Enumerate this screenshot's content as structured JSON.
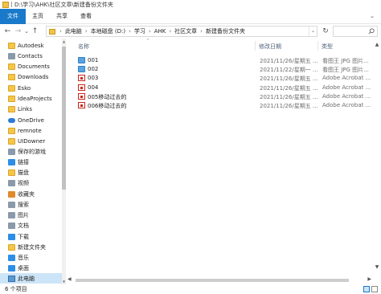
{
  "window": {
    "title": "D:\\学习\\AHK\\社区文章\\新建备份文件夹"
  },
  "ribbon": {
    "tabs": [
      "文件",
      "主页",
      "共享",
      "查看"
    ],
    "expand_glyph": "⌄"
  },
  "nav": {
    "back": "←",
    "forward": "→",
    "recent": "⌄",
    "up": "↑",
    "refresh": "↻",
    "address_dropdown": "⌄"
  },
  "breadcrumb": [
    "此电脑",
    "本地磁盘 (D:)",
    "学习",
    "AHK",
    "社区文章",
    "新建备份文件夹"
  ],
  "search": {
    "placeholder": ""
  },
  "sidebar": {
    "items": [
      {
        "label": "Autodesk",
        "icon": "folder-icon"
      },
      {
        "label": "Contacts",
        "icon": "contacts-icon"
      },
      {
        "label": "Documents",
        "icon": "documents-icon"
      },
      {
        "label": "Downloads",
        "icon": "downloads-icon"
      },
      {
        "label": "Esko",
        "icon": "folder-icon"
      },
      {
        "label": "IdeaProjects",
        "icon": "folder-icon"
      },
      {
        "label": "Links",
        "icon": "links-icon"
      },
      {
        "label": "OneDrive",
        "icon": "onedrive-icon"
      },
      {
        "label": "remnote",
        "icon": "folder-icon"
      },
      {
        "label": "UIDowner",
        "icon": "folder-icon"
      },
      {
        "label": "保存的游戏",
        "icon": "saved-games-icon"
      },
      {
        "label": "链接",
        "icon": "links-icon"
      },
      {
        "label": "猫盘",
        "icon": "folder-icon"
      },
      {
        "label": "视频",
        "icon": "videos-icon"
      },
      {
        "label": "收藏夹",
        "icon": "favorites-icon"
      },
      {
        "label": "搜索",
        "icon": "search-icon"
      },
      {
        "label": "图片",
        "icon": "pictures-icon"
      },
      {
        "label": "文档",
        "icon": "documents-icon"
      },
      {
        "label": "下载",
        "icon": "downloads-icon"
      },
      {
        "label": "新建文件夹",
        "icon": "folder-icon"
      },
      {
        "label": "音乐",
        "icon": "music-icon"
      },
      {
        "label": "桌面",
        "icon": "desktop-icon"
      },
      {
        "label": "此电脑",
        "icon": "this-pc-icon",
        "selected": true
      }
    ]
  },
  "columns": {
    "name": "名称",
    "date": "修改日期",
    "type": "类型",
    "sort_glyph": "^"
  },
  "files": [
    {
      "name": "001",
      "date": "2021/11/26/星期五 ...",
      "type": "看图王 JPG 图片...",
      "icon": "jpg-folder-icon"
    },
    {
      "name": "002",
      "date": "2021/11/22/星期一 ...",
      "type": "看图王 JPG 图片...",
      "icon": "jpg-folder-icon"
    },
    {
      "name": "003",
      "date": "2021/11/26/星期五 ...",
      "type": "Adobe Acrobat ...",
      "icon": "pdf-icon"
    },
    {
      "name": "004",
      "date": "2021/11/26/星期五 ...",
      "type": "Adobe Acrobat ...",
      "icon": "pdf-icon"
    },
    {
      "name": "005移动过去的",
      "date": "2021/11/26/星期五 ...",
      "type": "Adobe Acrobat ...",
      "icon": "pdf-icon"
    },
    {
      "name": "006移动过去的",
      "date": "2021/11/26/星期五 ...",
      "type": "Adobe Acrobat ...",
      "icon": "pdf-icon"
    }
  ],
  "status": {
    "count": "6 个项目"
  }
}
